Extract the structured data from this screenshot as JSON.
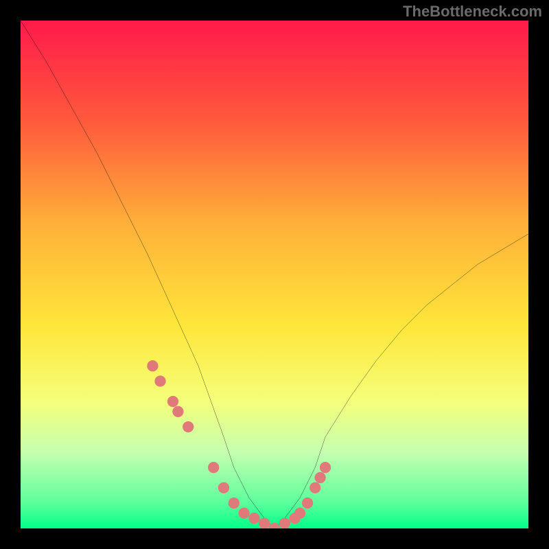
{
  "watermark": "TheBottleneck.com",
  "chart_data": {
    "type": "line",
    "title": "",
    "xlabel": "",
    "ylabel": "",
    "xlim": [
      0,
      100
    ],
    "ylim": [
      0,
      100
    ],
    "series": [
      {
        "name": "bottleneck-curve",
        "x": [
          0,
          5,
          10,
          15,
          20,
          25,
          30,
          35,
          40,
          42,
          45,
          48,
          50,
          52,
          55,
          58,
          60,
          65,
          70,
          75,
          80,
          85,
          90,
          95,
          100
        ],
        "values": [
          100,
          92,
          83,
          74,
          64,
          54,
          43,
          32,
          18,
          12,
          6,
          2,
          0,
          2,
          6,
          12,
          18,
          26,
          33,
          39,
          44,
          48,
          52,
          55,
          58
        ]
      }
    ],
    "markers": {
      "name": "highlight-points",
      "x": [
        26,
        27.5,
        30,
        31,
        33,
        38,
        40,
        42,
        44,
        46,
        48,
        50,
        52,
        54,
        55,
        56.5,
        58,
        59,
        60
      ],
      "values": [
        32,
        29,
        25,
        23,
        20,
        12,
        8,
        5,
        3,
        2,
        1,
        0,
        1,
        2,
        3,
        5,
        8,
        10,
        12
      ]
    },
    "marker_color": "#e07a7a",
    "curve_color": "#000000",
    "background_gradient": [
      "#ff1a4a",
      "#ff5a3c",
      "#ffb03a",
      "#ffe63a",
      "#f4ff7a",
      "#c6ffb0",
      "#5cff9c",
      "#00ff88"
    ]
  }
}
